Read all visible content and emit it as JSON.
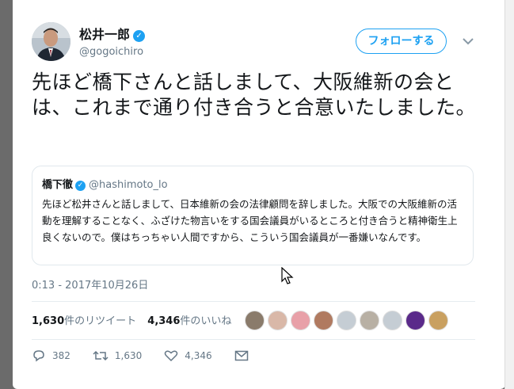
{
  "tweet": {
    "author_name": "松井一郎",
    "author_handle": "@gogoichiro",
    "follow_label": "フォローする",
    "text": "先ほど橋下さんと話しまして、大阪維新の会とは、これまで通り付き合うと合意いたしました。",
    "timestamp": "0:13 - 2017年10月26日"
  },
  "quote": {
    "author_name": "橋下徹",
    "author_handle": "@hashimoto_lo",
    "text": "先ほど松井さんと話しまして、日本維新の会の法律顧問を辞しました。大阪での大阪維新の活動を理解することなく、ふざけた物言いをする国会議員がいるところと付き合うと精神衛生上良くないので。僕はちっちゃい人間ですから、こういう国会議員が一番嫌いなんです。"
  },
  "stats": {
    "retweets_count": "1,630",
    "retweets_label": "件のリツイート",
    "likes_count": "4,346",
    "likes_label": "件のいいね"
  },
  "liker_avatar_colors": [
    "#8a7b6b",
    "#d9b8a8",
    "#e8a0a8",
    "#b07a60",
    "#c5cdd4",
    "#b8b0a4",
    "#c5cdd4",
    "#5a2a8a",
    "#c9a060"
  ],
  "actions": {
    "replies": "382",
    "retweets": "1,630",
    "likes": "4,346"
  },
  "colors": {
    "accent": "#1da1f2",
    "secondary_text": "#657786",
    "divider": "#e6ecf0"
  }
}
